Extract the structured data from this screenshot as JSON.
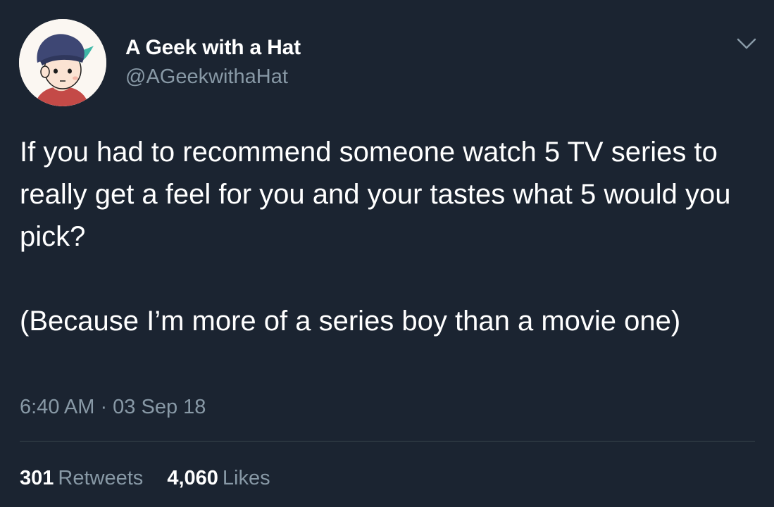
{
  "author": {
    "display_name": "A Geek with a Hat",
    "handle": "@AGeekwithaHat"
  },
  "tweet": {
    "paragraphs": [
      "If you had to recommend someone watch 5 TV series to really get a feel for you and your tastes what 5 would you pick?",
      "(Because I’m more of a series boy than a movie one)"
    ],
    "timestamp": "6:40 AM · 03 Sep 18"
  },
  "stats": {
    "retweets_count": "301",
    "retweets_label": "Retweets",
    "likes_count": "4,060",
    "likes_label": "Likes"
  },
  "icons": {
    "menu": "chevron-down-icon",
    "avatar": "cartoon-beanie-avatar"
  },
  "colors": {
    "background": "#1b2431",
    "primary_text": "#ffffff",
    "secondary_text": "#8899a6",
    "divider": "#38444d"
  }
}
